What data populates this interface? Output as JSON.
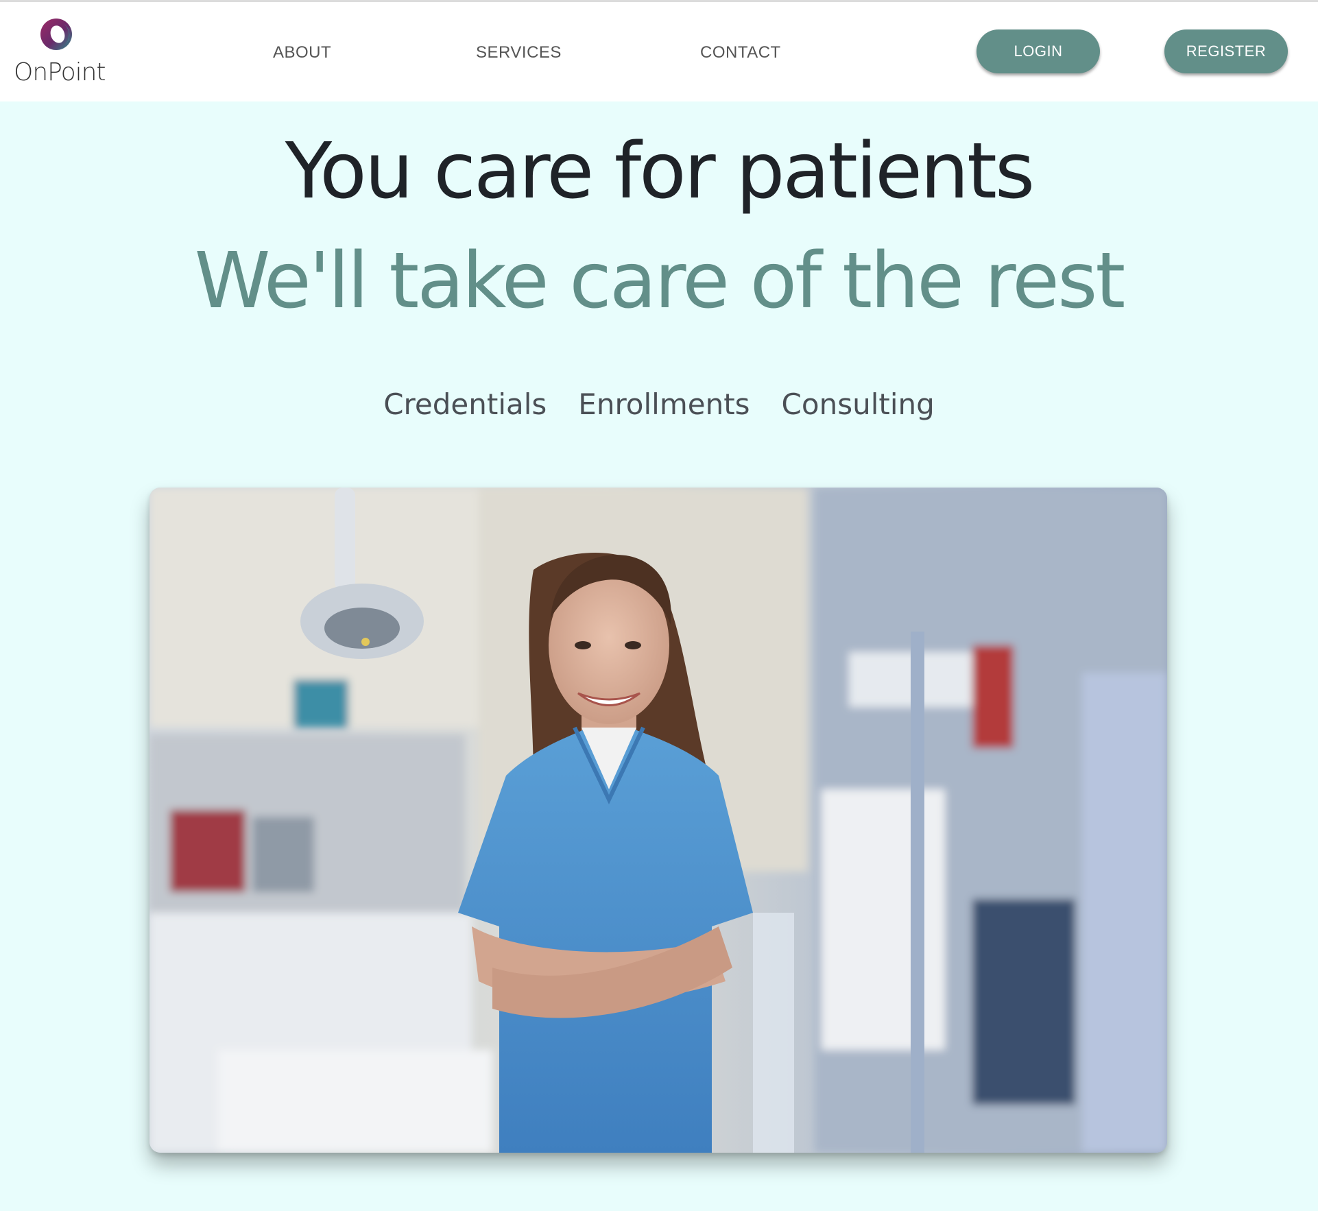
{
  "brand": {
    "name": "OnPoint",
    "logo_icon": "ring-logo-icon",
    "logo_colors": [
      "#8a2a5c",
      "#2f8a8a"
    ]
  },
  "nav": {
    "about": "ABOUT",
    "services": "SERVICES",
    "contact": "CONTACT"
  },
  "actions": {
    "login": "LOGIN",
    "register": "REGISTER"
  },
  "hero": {
    "line1": "You care for patients",
    "line2": "We'll take care of the rest",
    "services": [
      "Credentials",
      "Enrollments",
      "Consulting"
    ]
  },
  "image": {
    "subject": "smiling-dentist-in-clinic"
  },
  "colors": {
    "accent": "#628f89",
    "background": "#e8fdfc",
    "header": "#ffffff",
    "heading": "#1f2328"
  }
}
